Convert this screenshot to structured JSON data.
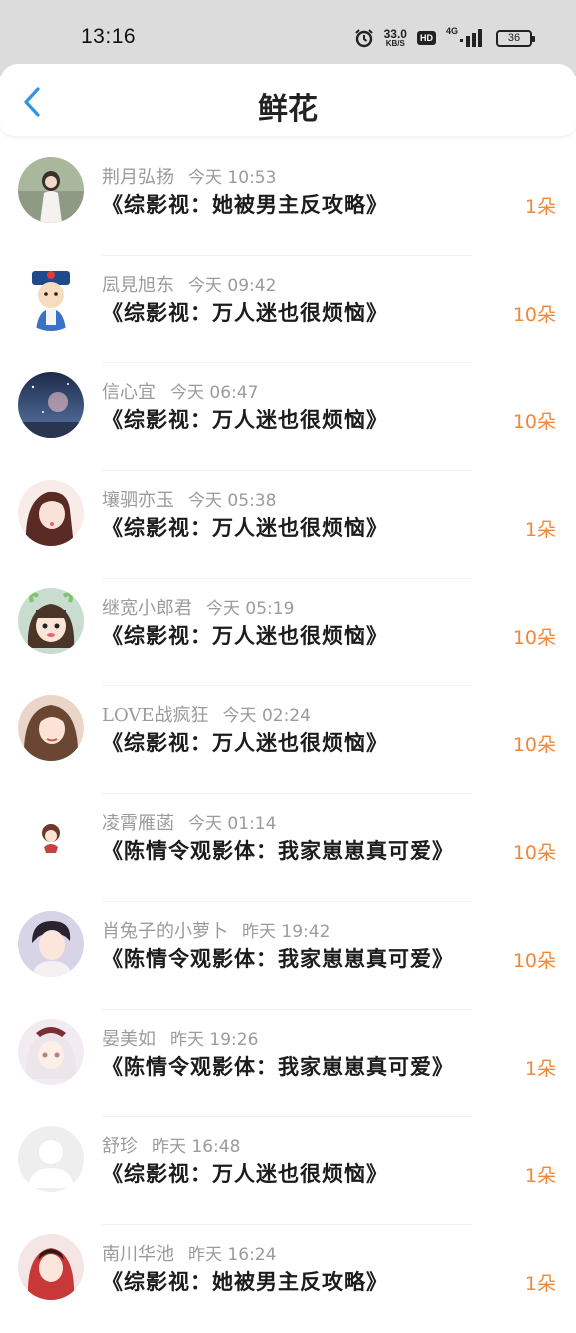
{
  "status_bar": {
    "time": "13:16",
    "net_speed_value": "33.0",
    "net_speed_unit": "KB/S",
    "hd_label": "HD",
    "net_type": "4G",
    "battery": "36"
  },
  "header": {
    "title": "鲜花",
    "back_icon": "chevron-left-icon"
  },
  "colors": {
    "accent_blue": "#2f93e8",
    "flower_orange": "#f0883a",
    "name_gray": "#9b9b9b"
  },
  "rows": [
    {
      "name": "荆月弘扬",
      "time": "今天 10:53",
      "book": "《综影视：她被男主反攻略》",
      "count": "1朵"
    },
    {
      "name": "凨見旭东",
      "time": "今天 09:42",
      "book": "《综影视：万人迷也很烦恼》",
      "count": "10朵"
    },
    {
      "name": "信心宜",
      "time": "今天 06:47",
      "book": "《综影视：万人迷也很烦恼》",
      "count": "10朵"
    },
    {
      "name": "壤驷亦玉",
      "time": "今天 05:38",
      "book": "《综影视：万人迷也很烦恼》",
      "count": "1朵"
    },
    {
      "name": "继宽小郎君",
      "time": "今天 05:19",
      "book": "《综影视：万人迷也很烦恼》",
      "count": "10朵"
    },
    {
      "name": "LOVE战疯狂",
      "time": "今天 02:24",
      "book": "《综影视：万人迷也很烦恼》",
      "count": "10朵"
    },
    {
      "name": "凌霄雁菡",
      "time": "今天 01:14",
      "book": "《陈情令观影体：我家崽崽真可爱》",
      "count": "10朵"
    },
    {
      "name": "肖兔子的小萝卜",
      "time": "昨天 19:42",
      "book": "《陈情令观影体：我家崽崽真可爱》",
      "count": "10朵"
    },
    {
      "name": "晏美如",
      "time": "昨天 19:26",
      "book": "《陈情令观影体：我家崽崽真可爱》",
      "count": "1朵"
    },
    {
      "name": "舒珍",
      "time": "昨天 16:48",
      "book": "《综影视：万人迷也很烦恼》",
      "count": "1朵"
    },
    {
      "name": "南川华池",
      "time": "昨天 16:24",
      "book": "《综影视：她被男主反攻略》",
      "count": "1朵"
    }
  ]
}
